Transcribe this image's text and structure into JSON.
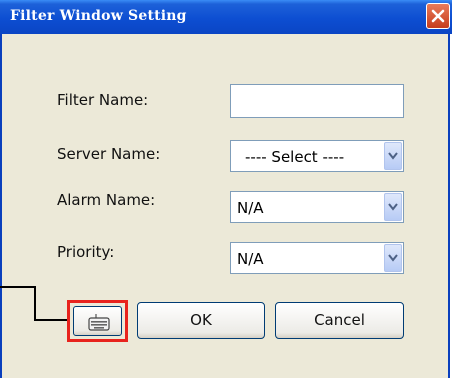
{
  "dialog": {
    "title": "Filter Window Setting",
    "close_icon": "close-icon"
  },
  "fields": {
    "filter_name": {
      "label": "Filter Name:",
      "value": ""
    },
    "server_name": {
      "label": "Server Name:",
      "value": "---- Select ----"
    },
    "alarm_name": {
      "label": "Alarm Name:",
      "value": "N/A"
    },
    "priority": {
      "label": "Priority:",
      "value": "N/A"
    }
  },
  "buttons": {
    "keyboard_icon": "keyboard-icon",
    "ok_label": "OK",
    "cancel_label": "Cancel"
  },
  "colors": {
    "titlebar": "#0a45c4",
    "dialog_bg": "#ece9d8",
    "highlight": "#e8231d"
  }
}
